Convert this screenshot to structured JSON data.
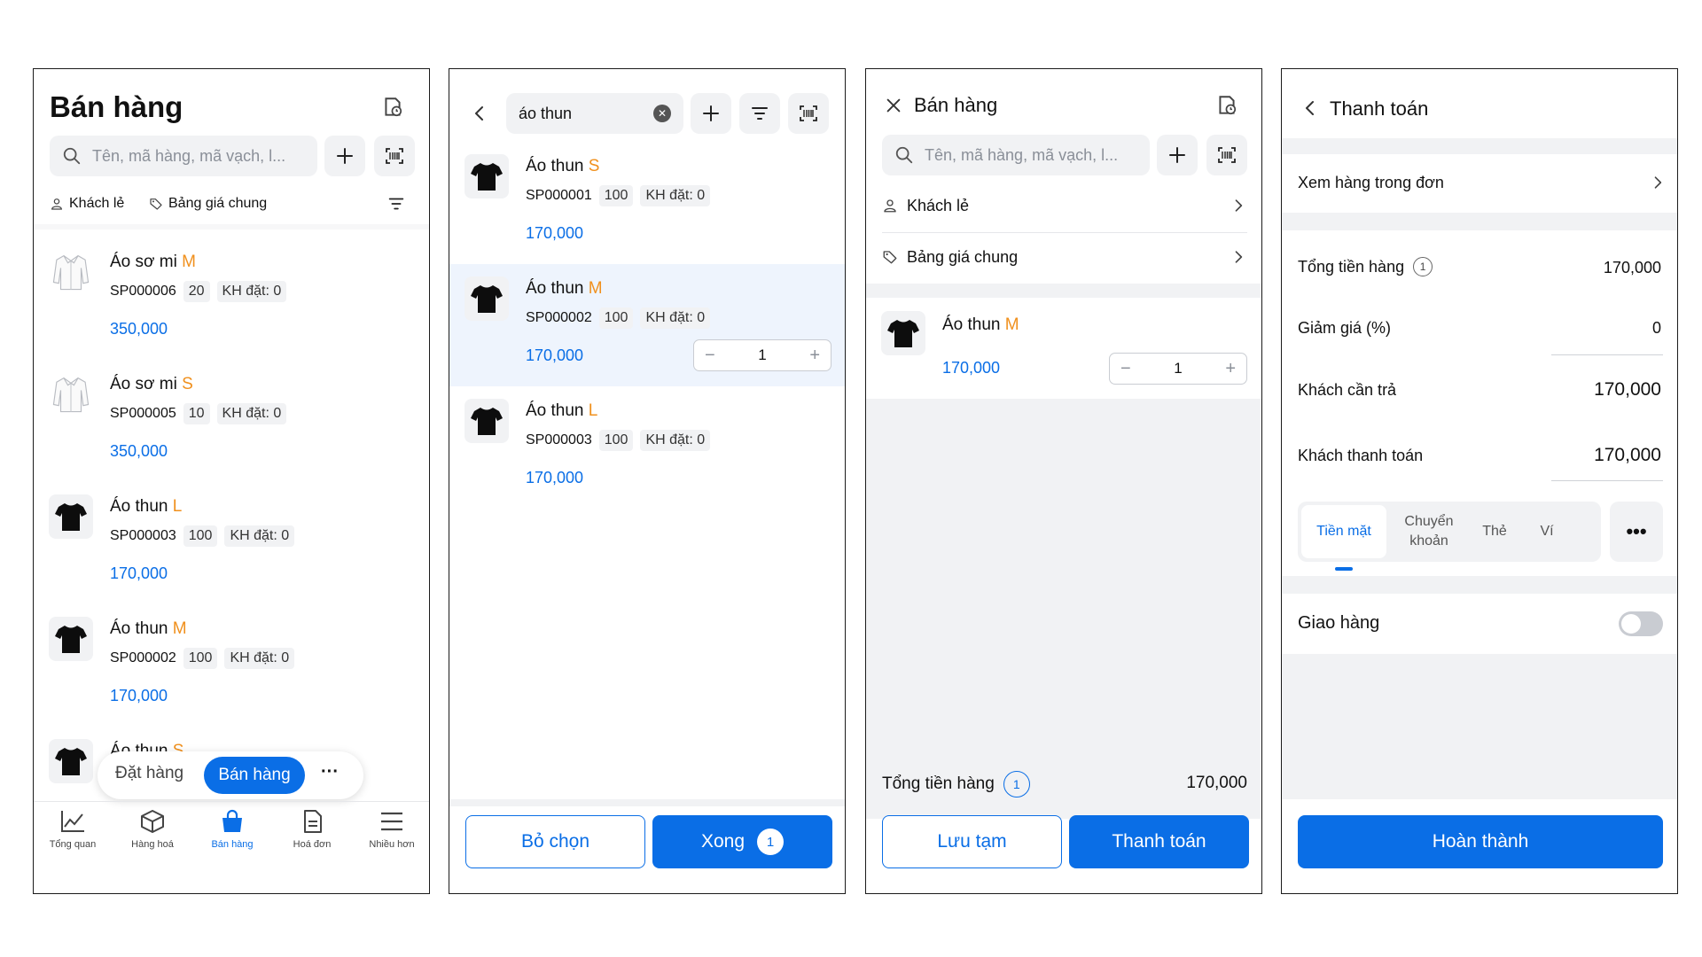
{
  "colors": {
    "accent": "#0a6ee6",
    "size": "#f0901d",
    "muted": "#8a8f98",
    "bg_soft": "#f1f2f4"
  },
  "screen1": {
    "title": "Bán hàng",
    "search_placeholder": "Tên, mã hàng, mã vạch, l...",
    "customer": "Khách lẻ",
    "pricebook": "Bảng giá chung",
    "products": [
      {
        "name": "Áo sơ mi",
        "size": "M",
        "code": "SP000006",
        "stock": "20",
        "ordered": "KH đặt: 0",
        "price": "350,000",
        "icon": "shirt-icon"
      },
      {
        "name": "Áo sơ mi",
        "size": "S",
        "code": "SP000005",
        "stock": "10",
        "ordered": "KH đặt: 0",
        "price": "350,000",
        "icon": "shirt-icon"
      },
      {
        "name": "Áo thun",
        "size": "L",
        "code": "SP000003",
        "stock": "100",
        "ordered": "KH đặt: 0",
        "price": "170,000",
        "icon": "tshirt-icon"
      },
      {
        "name": "Áo thun",
        "size": "M",
        "code": "SP000002",
        "stock": "100",
        "ordered": "KH đặt: 0",
        "price": "170,000",
        "icon": "tshirt-icon"
      },
      {
        "name": "Áo thun",
        "size": "S",
        "icon": "tshirt-icon"
      }
    ],
    "mode_switch": {
      "order": "Đặt hàng",
      "sell": "Bán hàng",
      "more": "···"
    },
    "nav": [
      "Tổng quan",
      "Hàng hoá",
      "Bán hàng",
      "Hoá đơn",
      "Nhiều hơn"
    ]
  },
  "screen2": {
    "search_value": "áo thun",
    "products": [
      {
        "name": "Áo thun",
        "size": "S",
        "code": "SP000001",
        "stock": "100",
        "ordered": "KH đặt: 0",
        "price": "170,000"
      },
      {
        "name": "Áo thun",
        "size": "M",
        "code": "SP000002",
        "stock": "100",
        "ordered": "KH đặt: 0",
        "price": "170,000",
        "qty": "1"
      },
      {
        "name": "Áo thun",
        "size": "L",
        "code": "SP000003",
        "stock": "100",
        "ordered": "KH đặt: 0",
        "price": "170,000"
      }
    ],
    "deselect": "Bỏ chọn",
    "done": "Xong",
    "done_count": "1"
  },
  "screen3": {
    "title": "Bán hàng",
    "search_placeholder": "Tên, mã hàng, mã vạch, l...",
    "customer": "Khách lẻ",
    "pricebook": "Bảng giá chung",
    "cart_item": {
      "name": "Áo thun",
      "size": "M",
      "price": "170,000",
      "qty": "1"
    },
    "total_label": "Tổng tiền hàng",
    "total_count": "1",
    "total_value": "170,000",
    "save_draft": "Lưu tạm",
    "pay": "Thanh toán"
  },
  "screen4": {
    "title": "Thanh toán",
    "view_items": "Xem hàng trong đơn",
    "subtotal_label": "Tổng tiền hàng",
    "subtotal_count": "1",
    "subtotal_value": "170,000",
    "discount_label": "Giảm giá (%)",
    "discount_value": "0",
    "to_pay_label": "Khách cần trả",
    "to_pay_value": "170,000",
    "paid_label": "Khách thanh toán",
    "paid_value": "170,000",
    "methods": [
      "Tiền mặt",
      "Chuyển khoản",
      "Thẻ",
      "Ví"
    ],
    "delivery_label": "Giao hàng",
    "delivery_on": false,
    "complete": "Hoàn thành"
  }
}
